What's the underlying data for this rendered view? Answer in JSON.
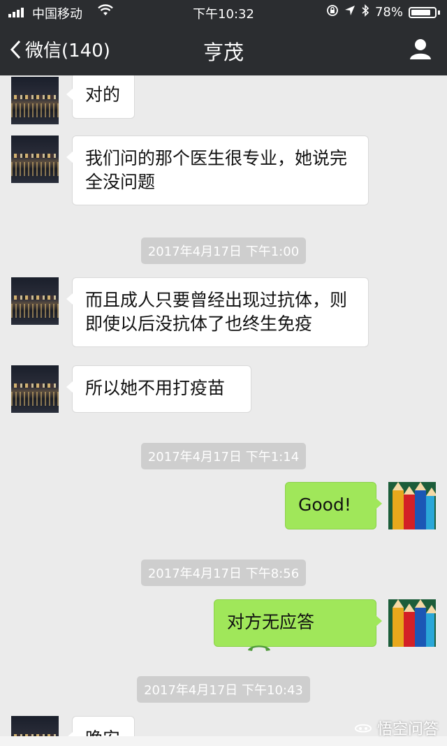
{
  "status_bar": {
    "carrier": "中国移动",
    "time": "下午10:32",
    "battery": "78%"
  },
  "nav": {
    "back_label": "微信(140)",
    "title": "亨茂"
  },
  "messages": {
    "m1": "对的",
    "m2": "我们问的那个医生很专业，她说完全没问题",
    "ts1": "2017年4月17日 下午1:00",
    "m3": "而且成人只要曾经出现过抗体，则即使以后没抗体了也终生免疫",
    "m4": "所以她不用打疫苗",
    "ts2": "2017年4月17日 下午1:14",
    "m5": "Good!",
    "ts3": "2017年4月17日 下午8:56",
    "m6": "对方无应答",
    "ts4": "2017年4月17日 下午10:43",
    "m7": "晚安"
  },
  "watermark": "悟空问答",
  "colors": {
    "nav_bg": "#2b2d30",
    "chat_bg": "#ebebeb",
    "sent_bubble": "#a0e75a",
    "received_bubble": "#ffffff",
    "timestamp_bg": "#cecece"
  }
}
